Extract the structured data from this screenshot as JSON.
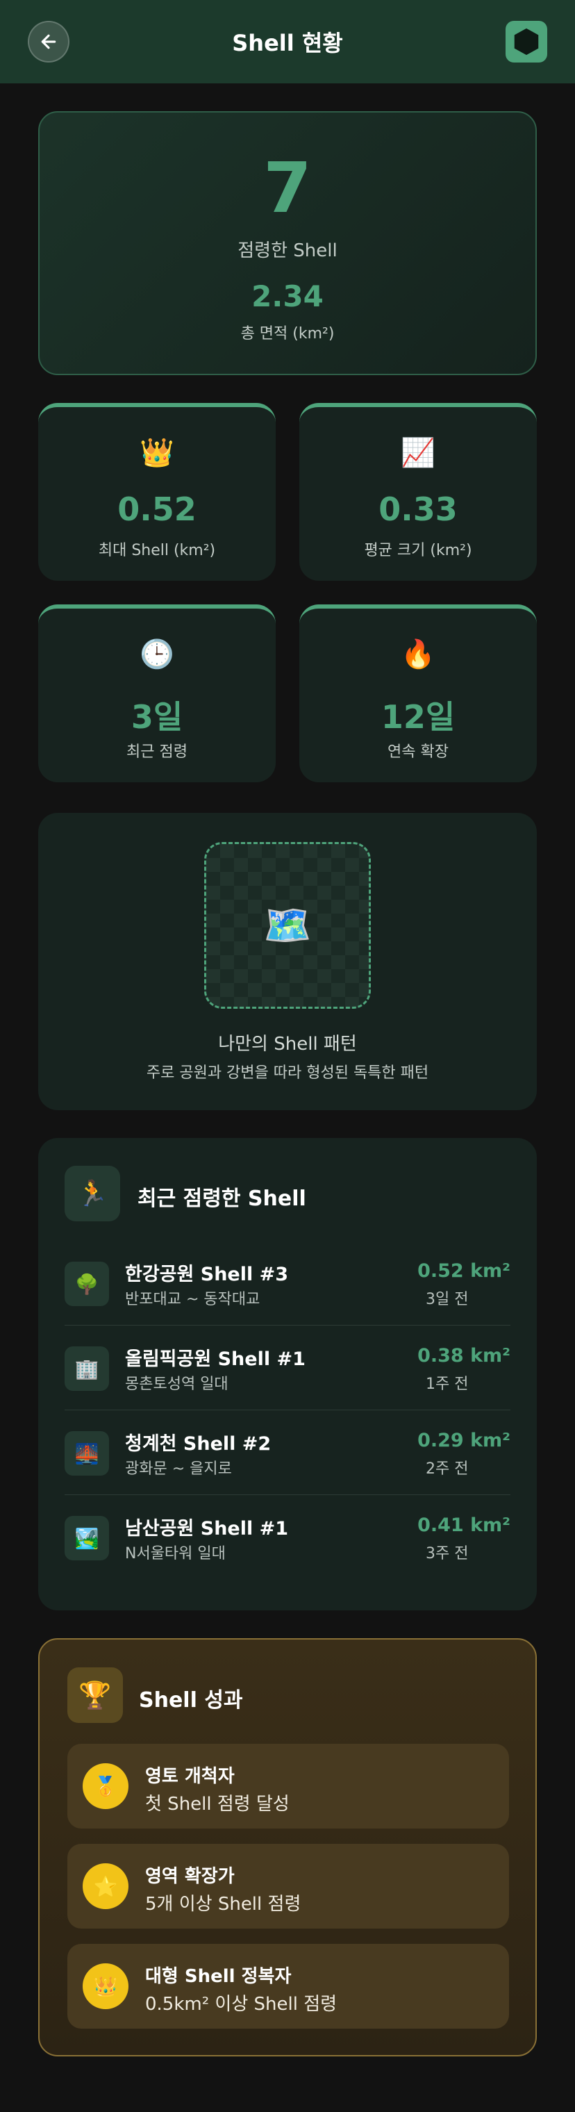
{
  "header": {
    "title": "Shell 현황",
    "back_icon": "arrow-left-icon",
    "logo_icon": "hexagon-logo-icon"
  },
  "summary": {
    "count": "7",
    "count_label": "점령한 Shell",
    "area": "2.34",
    "area_label": "총 면적 (km²)"
  },
  "stats": [
    {
      "icon": "👑",
      "value": "0.52",
      "label": "최대 Shell (km²)"
    },
    {
      "icon": "📈",
      "value": "0.33",
      "label": "평균 크기 (km²)"
    },
    {
      "icon": "🕒",
      "value": "3일",
      "label": "최근 점령"
    },
    {
      "icon": "🔥",
      "value": "12일",
      "label": "연속 확장"
    }
  ],
  "pattern": {
    "icon": "🗺️",
    "title": "나만의 Shell 패턴",
    "description": "주로 공원과 강변을 따라 형성된 독특한 패턴"
  },
  "recent": {
    "icon": "🏃",
    "title": "최근 점령한 Shell",
    "items": [
      {
        "icon": "🌳",
        "name": "한강공원 Shell #3",
        "location": "반포대교 ~ 동작대교",
        "area": "0.52 km²",
        "time": "3일 전"
      },
      {
        "icon": "🏢",
        "name": "올림픽공원 Shell #1",
        "location": "몽촌토성역 일대",
        "area": "0.38 km²",
        "time": "1주 전"
      },
      {
        "icon": "🌉",
        "name": "청계천 Shell #2",
        "location": "광화문 ~ 을지로",
        "area": "0.29 km²",
        "time": "2주 전"
      },
      {
        "icon": "🏞️",
        "name": "남산공원 Shell #1",
        "location": "N서울타워 일대",
        "area": "0.41 km²",
        "time": "3주 전"
      }
    ]
  },
  "achievements": {
    "icon": "🏆",
    "title": "Shell 성과",
    "items": [
      {
        "icon": "🥇",
        "name": "영토 개척자",
        "description": "첫 Shell 점령 달성"
      },
      {
        "icon": "⭐",
        "name": "영역 확장가",
        "description": "5개 이상 Shell 점령"
      },
      {
        "icon": "👑",
        "name": "대형 Shell 정복자",
        "description": "0.5km² 이상 Shell 점령"
      }
    ]
  },
  "colors": {
    "accent": "#4ea47b",
    "header_bg": "#1c3a2c",
    "gold": "#f2c318"
  }
}
